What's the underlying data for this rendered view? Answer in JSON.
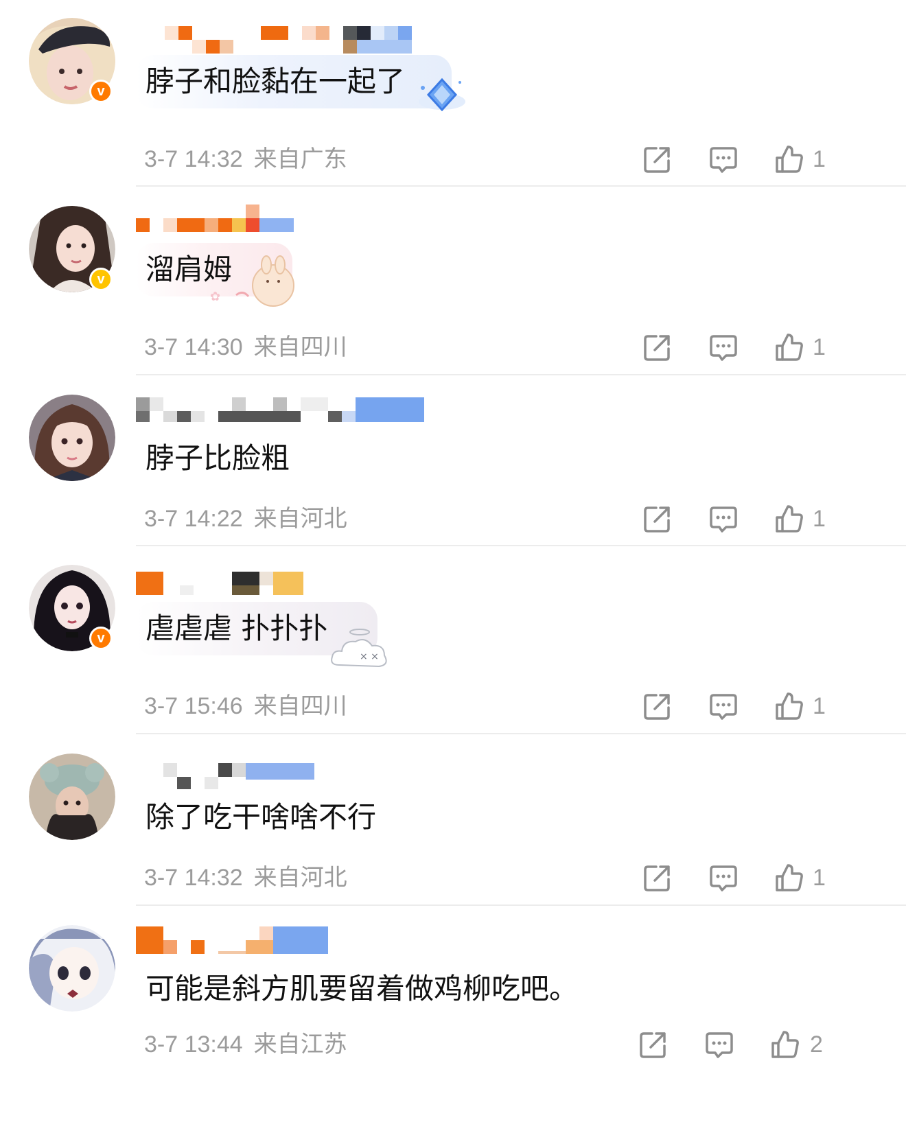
{
  "colors": {
    "meta_text": "#9b9b9b",
    "comment_text": "#111111",
    "verified_orange": "#ff7a00",
    "verified_yellow": "#ffc400",
    "divider": "#ececec"
  },
  "comments": [
    {
      "text": "脖子和脸黏在一起了",
      "date": "3-7 14:32",
      "location": "来自广东",
      "likes": "1",
      "verified": "orange",
      "avatar_icon": "avatar-girl-cap-icon",
      "sticker_icon": "diamond-icon"
    },
    {
      "text": "溜肩姆",
      "date": "3-7 14:30",
      "location": "来自四川",
      "likes": "1",
      "verified": "yellow",
      "avatar_icon": "avatar-girl-lace-icon",
      "sticker_icon": "bunny-icon"
    },
    {
      "text": "脖子比脸粗",
      "date": "3-7 14:22",
      "location": "来自河北",
      "likes": "1",
      "verified": "none",
      "avatar_icon": "avatar-girl-bangs-icon",
      "sticker_icon": ""
    },
    {
      "text": "虐虐虐 扑扑扑",
      "date": "3-7 15:46",
      "location": "来自四川",
      "likes": "1",
      "verified": "orange",
      "avatar_icon": "avatar-doll-icon",
      "sticker_icon": "cloud-ghost-icon"
    },
    {
      "text": "除了吃干啥啥不行",
      "date": "3-7 14:32",
      "location": "来自河北",
      "likes": "1",
      "verified": "none",
      "avatar_icon": "avatar-mouse-hat-icon",
      "sticker_icon": ""
    },
    {
      "text": "可能是斜方肌要留着做鸡柳吃吧。",
      "date": "3-7 13:44",
      "location": "来自江苏",
      "likes": "2",
      "verified": "none",
      "avatar_icon": "avatar-anime-icon",
      "sticker_icon": ""
    }
  ]
}
